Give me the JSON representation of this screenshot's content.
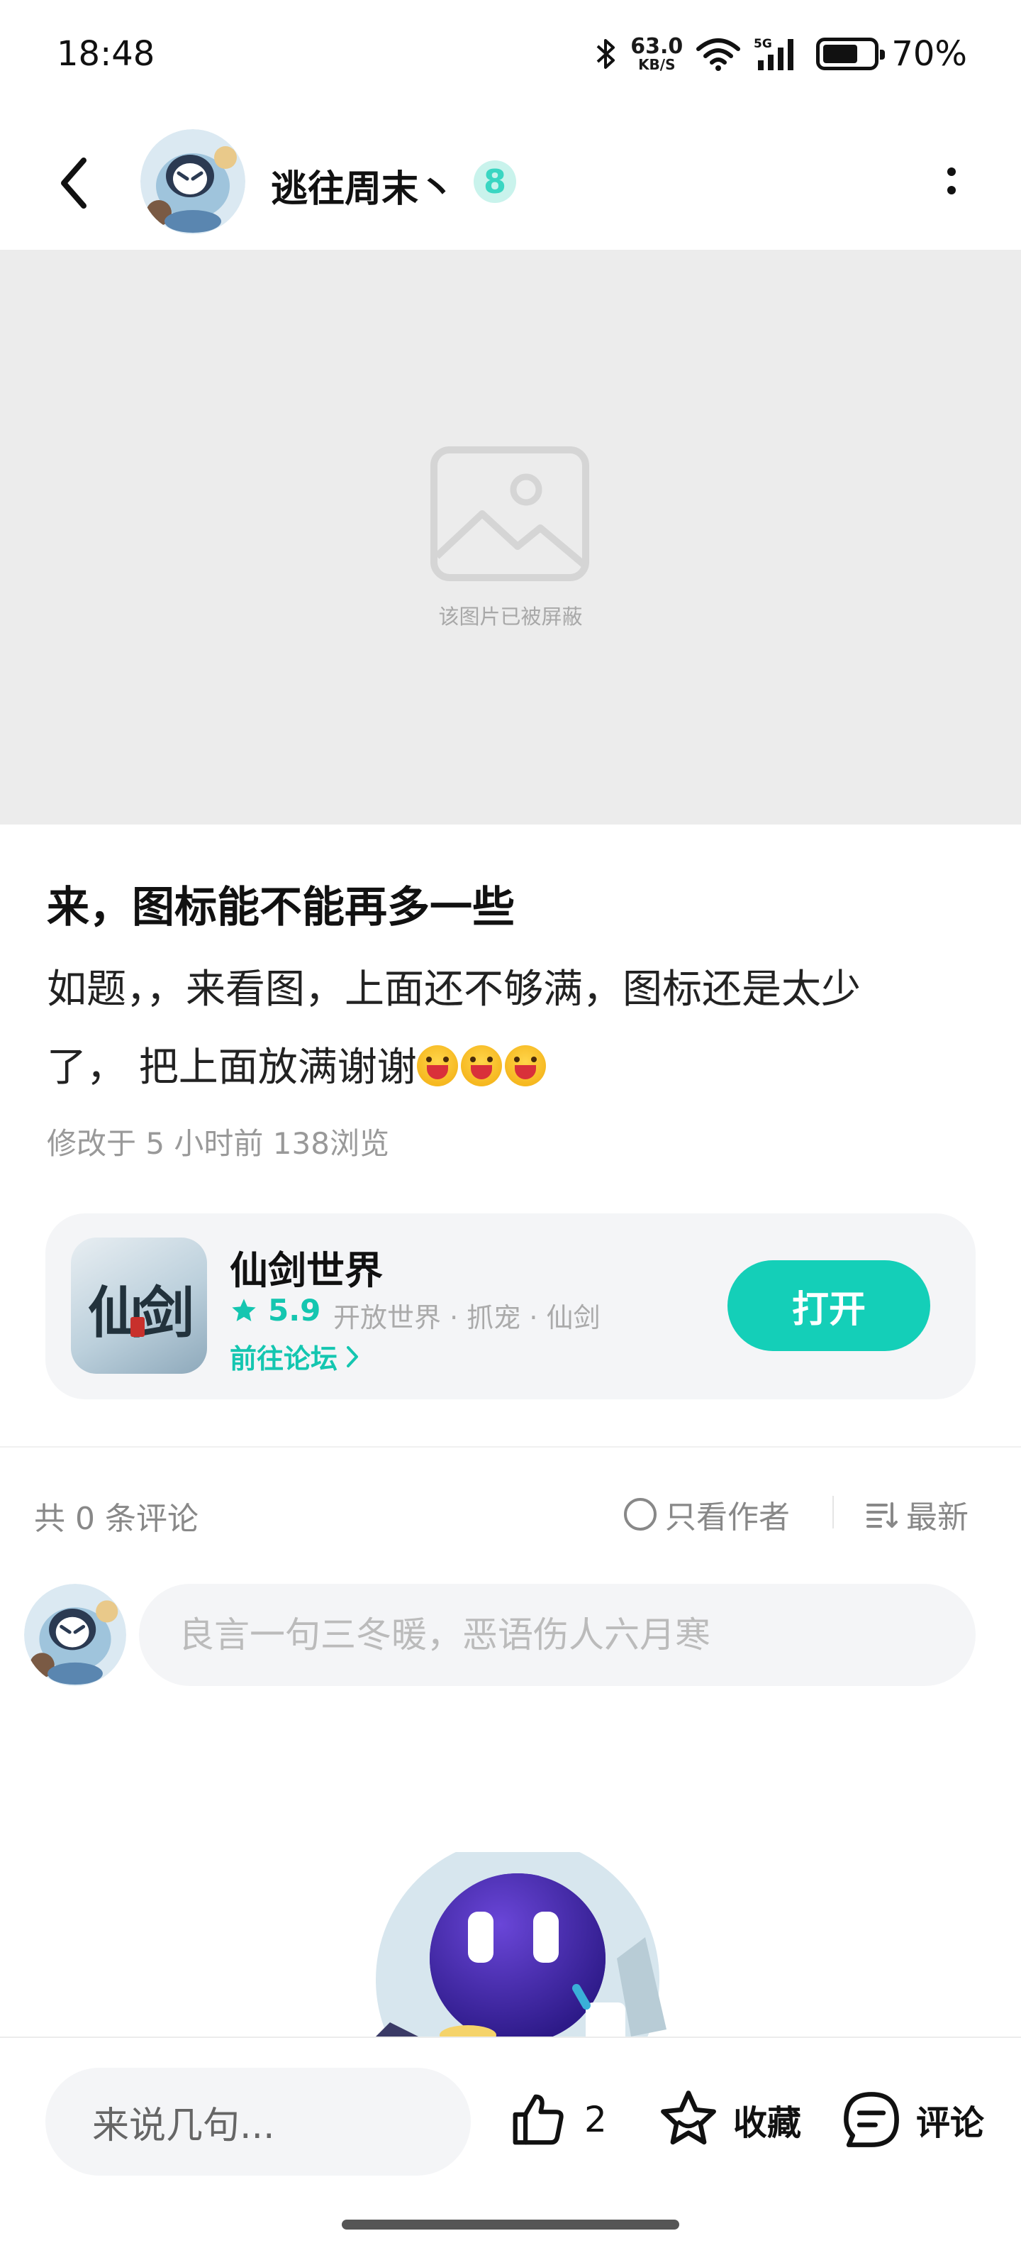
{
  "status_bar": {
    "time": "18:48",
    "net_speed": "63.0",
    "net_unit": "KB/S",
    "battery_percent": "70%",
    "battery_level": 0.7,
    "icons": [
      "bluetooth-icon",
      "wifi-icon",
      "5g-signal-icon",
      "battery-icon"
    ]
  },
  "nav": {
    "username": "逃往周末丶",
    "level": "8"
  },
  "blocked_image": {
    "text": "该图片已被屏蔽"
  },
  "post": {
    "title": "来，图标能不能再多一些",
    "body_line1": "如题，，来看图，上面还不够满，图标还是太少",
    "body_line2": "了，  把上面放满谢谢",
    "emoji_count": 3,
    "meta": "修改于 5 小时前  138浏览"
  },
  "game": {
    "name": "仙剑世界",
    "score": "5.9",
    "tags": "开放世界 · 抓宠 · 仙剑",
    "forum_link": "前往论坛",
    "open_label": "打开",
    "icon_glyph": "仙剑"
  },
  "comments": {
    "count_label": "共 0 条评论",
    "author_only_label": "只看作者",
    "sort_label": "最新",
    "input_placeholder": "良言一句三冬暖，恶语伤人六月寒"
  },
  "bottom_bar": {
    "say_placeholder": "来说几句...",
    "like_count": "2",
    "favorite_label": "收藏",
    "comment_label": "评论"
  },
  "colors": {
    "accent": "#14cfb8",
    "accent_text": "#14c6b0",
    "card_bg": "#f4f5f7",
    "blocked_bg": "#ececec"
  }
}
